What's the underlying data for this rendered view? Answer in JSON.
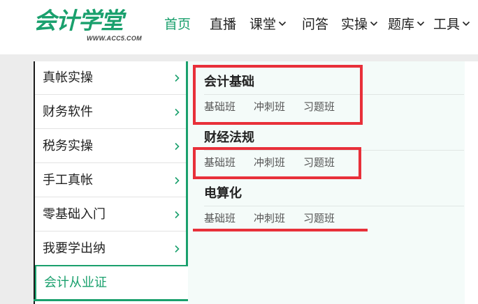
{
  "logo": {
    "main": "会计学堂",
    "sub": "WWW.ACC5.COM"
  },
  "nav": [
    {
      "label": "首页",
      "active": true,
      "dropdown": false
    },
    {
      "label": "直播",
      "active": false,
      "dropdown": false
    },
    {
      "label": "课堂",
      "active": false,
      "dropdown": true
    },
    {
      "label": "问答",
      "active": false,
      "dropdown": false
    },
    {
      "label": "实操",
      "active": false,
      "dropdown": true
    },
    {
      "label": "题库",
      "active": false,
      "dropdown": true
    },
    {
      "label": "工具",
      "active": false,
      "dropdown": true
    }
  ],
  "sidebar": {
    "items": [
      {
        "label": "真帐实操"
      },
      {
        "label": "财务软件"
      },
      {
        "label": "税务实操"
      },
      {
        "label": "手工真帐"
      },
      {
        "label": "零基础入门"
      },
      {
        "label": "我要学出纳"
      },
      {
        "label": "会计从业证",
        "active": true
      }
    ]
  },
  "content": {
    "sections": [
      {
        "title": "会计基础",
        "courses": [
          "基础班",
          "冲刺班",
          "习题班"
        ]
      },
      {
        "title": "财经法规",
        "courses": [
          "基础班",
          "冲刺班",
          "习题班"
        ]
      },
      {
        "title": "电算化",
        "courses": [
          "基础班",
          "冲刺班",
          "习题班"
        ]
      }
    ]
  },
  "colors": {
    "brand": "#1aa06d",
    "annotation": "#e8303a"
  },
  "icons": {
    "nav_dropdown": "chevron-down-icon",
    "sidebar_arrow": "chevron-right-icon"
  }
}
